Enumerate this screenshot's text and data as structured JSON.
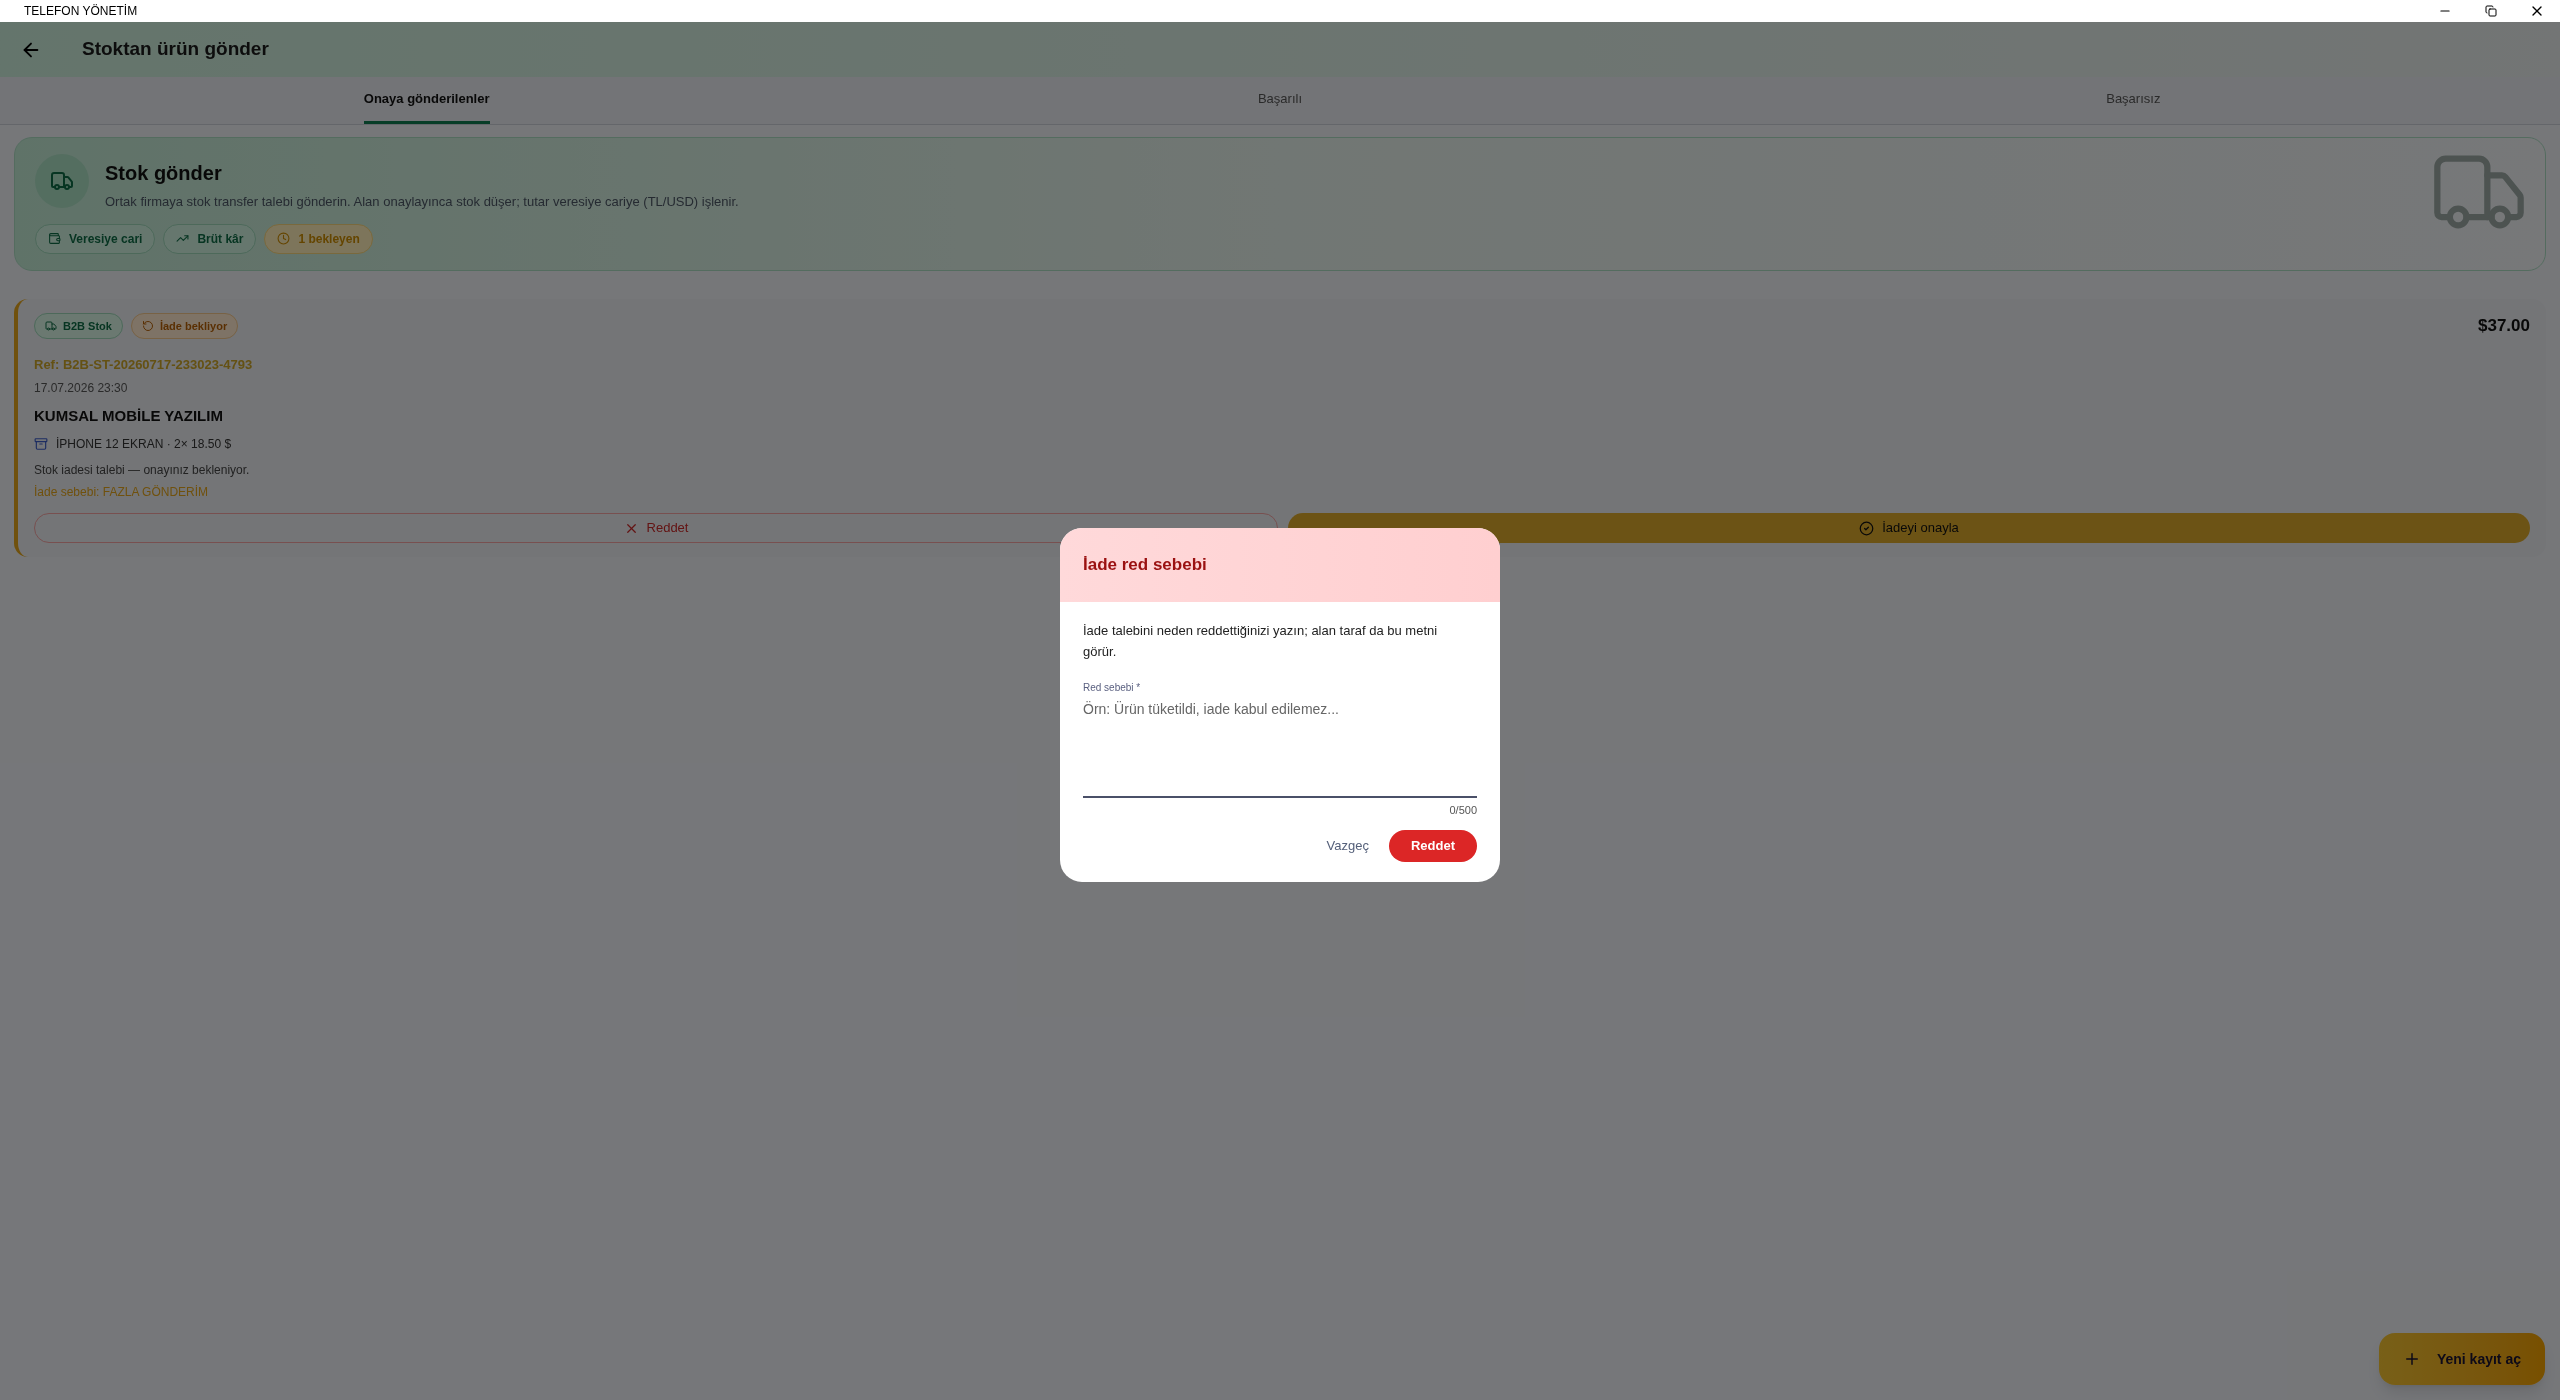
{
  "window": {
    "title": "TELEFON YÖNETİM"
  },
  "app_bar": {
    "title": "Stoktan ürün gönder"
  },
  "tabs": [
    {
      "label": "Onaya gönderilenler",
      "selected": true
    },
    {
      "label": "Başarılı",
      "selected": false
    },
    {
      "label": "Başarısız",
      "selected": false
    }
  ],
  "hero": {
    "title": "Stok gönder",
    "description": "Ortak firmaya stok transfer talebi gönderin. Alan onaylayınca stok düşer; tutar veresiye cariye (TL/USD) işlenir.",
    "chips": [
      {
        "kind": "wallet",
        "label": "Veresiye cari"
      },
      {
        "kind": "trend",
        "label": "Brüt kâr"
      },
      {
        "kind": "pending",
        "label": "1 bekleyen"
      }
    ]
  },
  "order": {
    "badges": [
      {
        "kind": "b2b",
        "label": "B2B Stok"
      },
      {
        "kind": "return",
        "label": "İade bekliyor"
      }
    ],
    "amount": "$37.00",
    "ref": "Ref: B2B-ST-20260717-233023-4793",
    "date": "17.07.2026 23:30",
    "company": "KUMSAL MOBİLE YAZILIM",
    "item": "İPHONE 12 EKRAN · 2× 18.50 $",
    "note": "Stok iadesi talebi — onayınız bekleniyor.",
    "reason": "İade sebebi: FAZLA GÖNDERİM",
    "reject_button": "Reddet",
    "approve_button": "İadeyi onayla"
  },
  "dialog": {
    "title": "İade red sebebi",
    "message": "İade talebini neden reddettiğinizi yazın; alan taraf da bu metni görür.",
    "field_label": "Red sebebi *",
    "placeholder": "Örn: Ürün tüketildi, iade kabul edilemez...",
    "counter": "0/500",
    "cancel_button": "Vazgeç",
    "confirm_button": "Reddet"
  },
  "fab": {
    "label": "Yeni kayıt aç"
  }
}
